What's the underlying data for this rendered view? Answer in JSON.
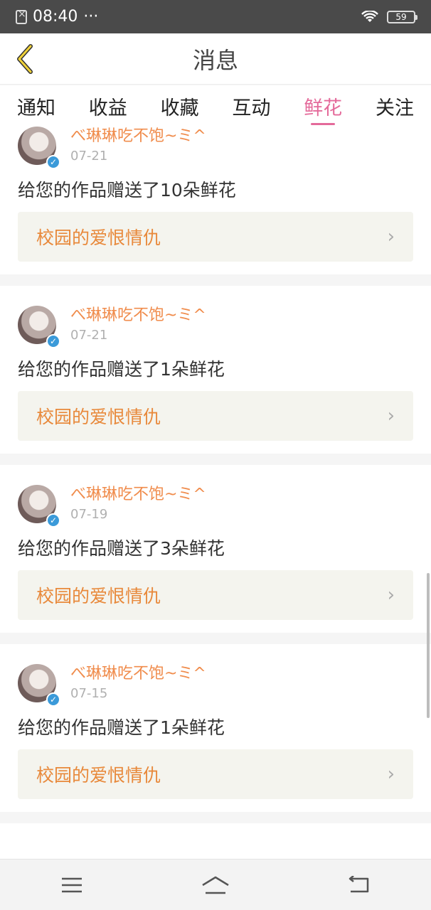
{
  "status_bar": {
    "time": "08:40",
    "dots": "···",
    "battery": "59"
  },
  "header": {
    "title": "消息"
  },
  "tabs": [
    {
      "label": "通知",
      "active": false
    },
    {
      "label": "收益",
      "active": false
    },
    {
      "label": "收藏",
      "active": false
    },
    {
      "label": "互动",
      "active": false
    },
    {
      "label": "鲜花",
      "active": true
    },
    {
      "label": "关注",
      "active": false
    }
  ],
  "messages": [
    {
      "username": "べ琳琳吃不饱~ミ^",
      "date": "07-21",
      "text": "给您的作品赠送了10朵鲜花",
      "work_title": "校园的爱恨情仇"
    },
    {
      "username": "べ琳琳吃不饱~ミ^",
      "date": "07-21",
      "text": "给您的作品赠送了1朵鲜花",
      "work_title": "校园的爱恨情仇"
    },
    {
      "username": "べ琳琳吃不饱~ミ^",
      "date": "07-19",
      "text": "给您的作品赠送了3朵鲜花",
      "work_title": "校园的爱恨情仇"
    },
    {
      "username": "べ琳琳吃不饱~ミ^",
      "date": "07-15",
      "text": "给您的作品赠送了1朵鲜花",
      "work_title": "校园的爱恨情仇"
    }
  ],
  "colors": {
    "accent": "#e46a9a",
    "username": "#f08c4c",
    "work_title": "#e8893b"
  },
  "icons": {
    "back": "back-chevron-icon",
    "verified": "verified-badge-icon",
    "chevron": "chevron-right-icon"
  }
}
